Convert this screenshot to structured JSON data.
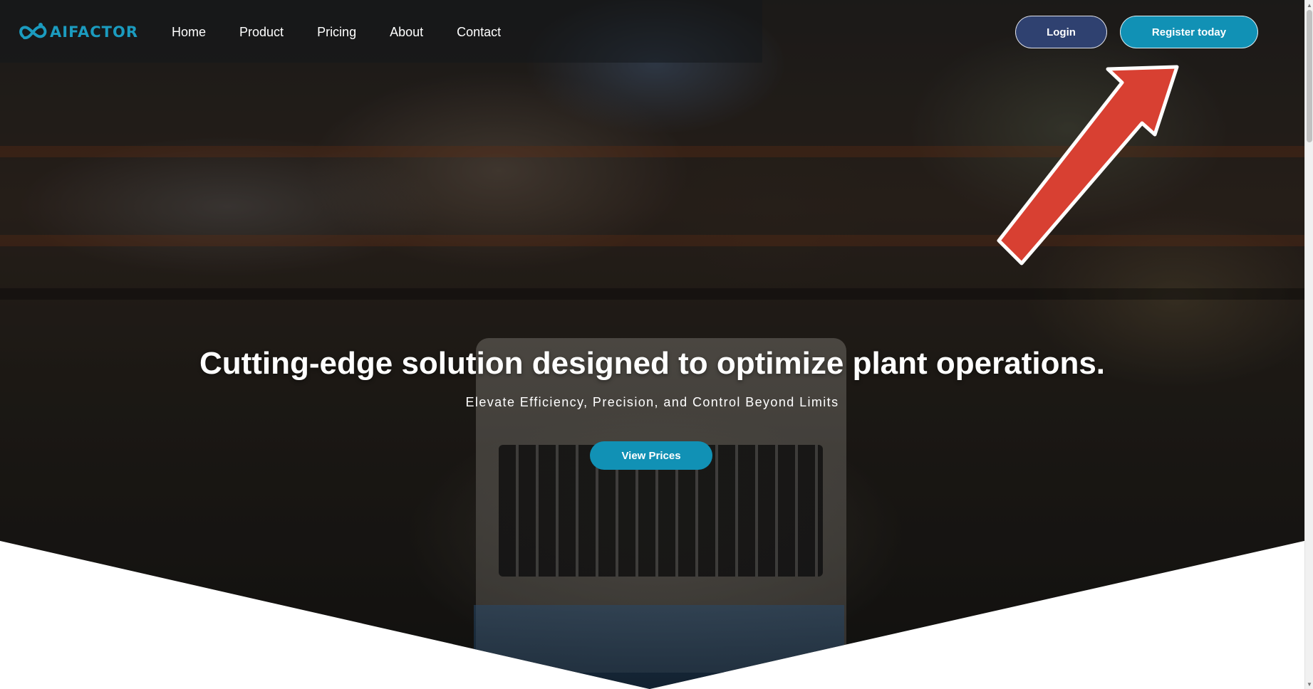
{
  "brand": {
    "name": "AIFACTOR",
    "color": "#1b9bbf"
  },
  "nav": {
    "links": [
      "Home",
      "Product",
      "Pricing",
      "About",
      "Contact"
    ]
  },
  "auth": {
    "login_label": "Login",
    "register_label": "Register today",
    "login_color": "#2f4170",
    "register_color": "#1191b5"
  },
  "hero": {
    "title": "Cutting-edge solution designed to optimize plant operations.",
    "subtitle": "Elevate Efficiency, Precision, and Control Beyond Limits",
    "cta_label": "View Prices",
    "cta_color": "#1191b5"
  },
  "annotation": {
    "icon": "red-arrow-icon",
    "color": "#d84032"
  },
  "icons": {
    "scroll_up": "▲",
    "scroll_down": "▼"
  }
}
